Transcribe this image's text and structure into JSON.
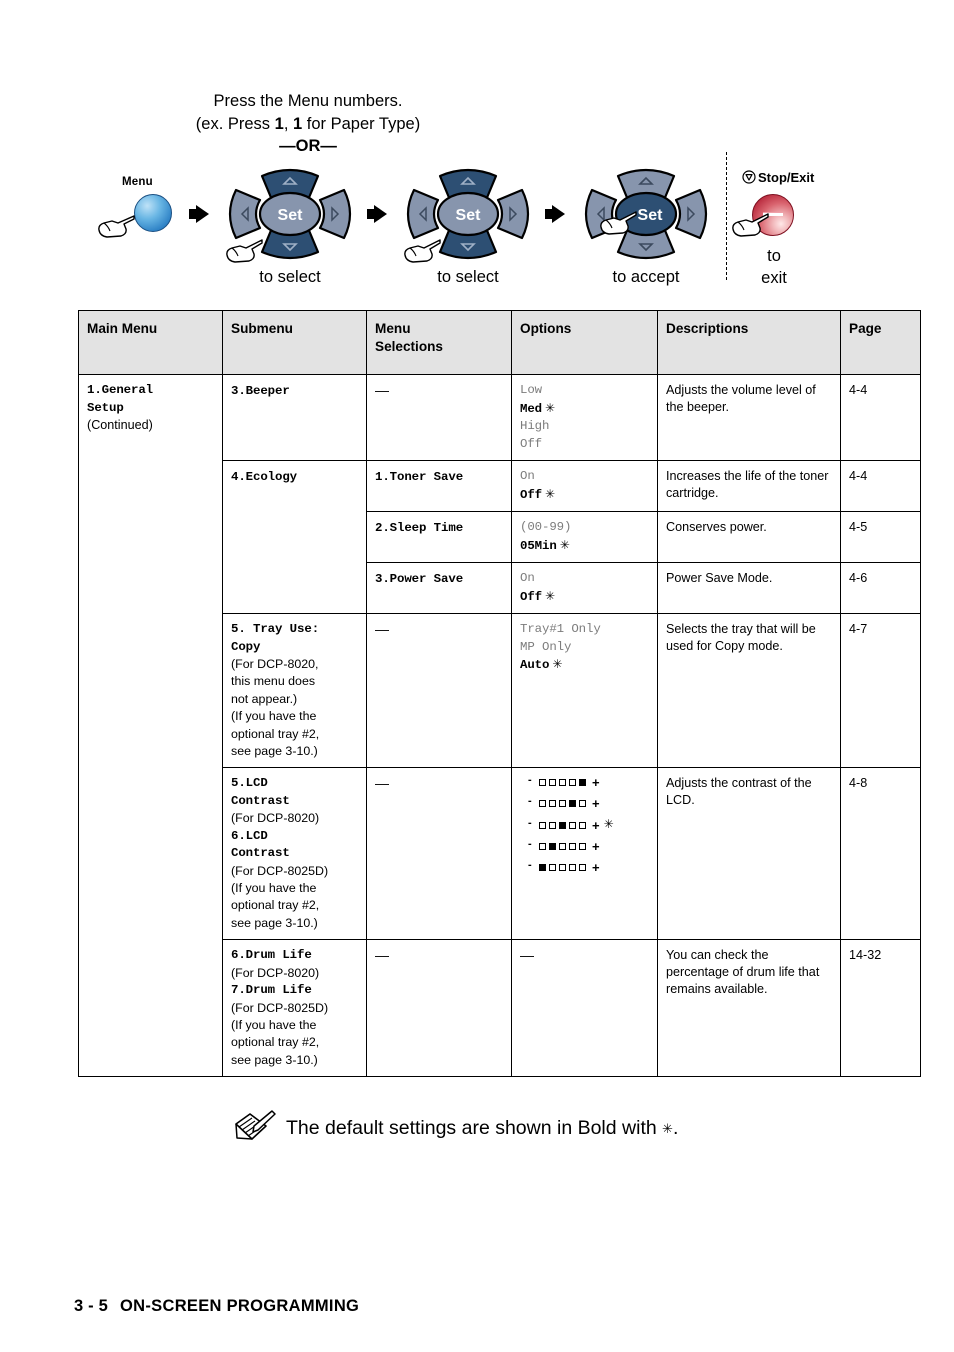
{
  "diagram": {
    "instruction_line1": "Press the Menu numbers.",
    "instruction_line2_pre": "(ex. Press ",
    "instruction_line2_key1": "1",
    "instruction_line2_mid": ", ",
    "instruction_line2_key2": "1",
    "instruction_line2_post": " for Paper Type)",
    "or_label": "—OR—",
    "menu_button_label": "Menu",
    "set_label_1": "Set",
    "set_label_2": "Set",
    "set_label_3": "Set",
    "caption_1": "to select",
    "caption_2": "to select",
    "caption_3": "to accept",
    "stop_exit_label": "Stop/Exit",
    "stop_caption_line1": "to",
    "stop_caption_line2": "exit"
  },
  "table": {
    "headers": {
      "main_menu": "Main Menu",
      "submenu": "Submenu",
      "menu_selections_l1": "Menu",
      "menu_selections_l2": "Selections",
      "options": "Options",
      "descriptions": "Descriptions",
      "page": "Page"
    },
    "main_menu": {
      "line1": "1.General",
      "line2": "Setup",
      "line3": "(Continued)"
    },
    "rows": [
      {
        "submenu": "3.Beeper",
        "selection": "—",
        "options": [
          {
            "text": "Low",
            "default": false
          },
          {
            "text": "Med",
            "default": true
          },
          {
            "text": "High",
            "default": false
          },
          {
            "text": "Off",
            "default": false
          }
        ],
        "description": "Adjusts the volume level of the beeper.",
        "page": "4-4"
      },
      {
        "submenu": "4.Ecology",
        "selection": "1.Toner Save",
        "options": [
          {
            "text": "On",
            "default": false
          },
          {
            "text": "Off",
            "default": true
          }
        ],
        "description": "Increases the life of the toner cartridge.",
        "page": "4-4"
      },
      {
        "submenu": "",
        "selection": "2.Sleep Time",
        "options": [
          {
            "text": "(00-99)",
            "default": false
          },
          {
            "text": "05Min",
            "default": true
          }
        ],
        "description": "Conserves power.",
        "page": "4-5"
      },
      {
        "submenu": "",
        "selection": "3.Power Save",
        "options": [
          {
            "text": "On",
            "default": false
          },
          {
            "text": "Off",
            "default": true
          }
        ],
        "description": "Power Save Mode.",
        "page": "4-6"
      },
      {
        "submenu_mono": [
          "5. Tray Use:",
          "Copy"
        ],
        "submenu_notes": [
          "(For DCP-8020,",
          "this menu does",
          "not appear.)",
          "(If you have the",
          "optional tray #2,",
          "see page 3-10.)"
        ],
        "selection": "—",
        "options": [
          {
            "text": "Tray#1 Only",
            "default": false
          },
          {
            "text": "MP Only",
            "default": false
          },
          {
            "text": "Auto",
            "default": true
          }
        ],
        "description": "Selects the tray that will be used for Copy mode.",
        "page": "4-7"
      },
      {
        "submenu_mono": [
          "5.LCD",
          "Contrast"
        ],
        "submenu_note_a": "(For DCP-8020)",
        "submenu_mono2": [
          "6.LCD",
          "Contrast"
        ],
        "submenu_notes": [
          "(For DCP-8025D)",
          "(If you have the",
          "optional tray #2,",
          "see page 3-10.)"
        ],
        "selection": "—",
        "lcd_bars": [
          {
            "filled_index": 4,
            "total": 5,
            "default": false
          },
          {
            "filled_index": 3,
            "total": 5,
            "default": false
          },
          {
            "filled_index": 2,
            "total": 5,
            "default": true
          },
          {
            "filled_index": 1,
            "total": 5,
            "default": false
          },
          {
            "filled_index": 0,
            "total": 5,
            "default": false
          }
        ],
        "lcd_minus": "-",
        "lcd_plus": "+",
        "description": "Adjusts the contrast of the LCD.",
        "page": "4-8"
      },
      {
        "submenu_mono": [
          "6.Drum Life"
        ],
        "submenu_note_a": "(For DCP-8020)",
        "submenu_mono2": [
          "7.Drum Life"
        ],
        "submenu_notes": [
          "(For DCP-8025D)",
          "(If you have the",
          "optional tray #2,",
          "see page 3-10.)"
        ],
        "selection": "—",
        "options_dash": "—",
        "description": "You can check the percentage of drum life that remains available.",
        "page": "14-32"
      }
    ]
  },
  "note": {
    "text": "The default settings are shown in Bold with",
    "star": "✳",
    "period": "."
  },
  "footer": {
    "page_number": "3 - 5",
    "title": "ON-SCREEN PROGRAMMING"
  },
  "colors": {
    "arrow_dark": "#2d4f73",
    "arrow_light": "#8795ad",
    "set_light": "#8795ad",
    "set_dark": "#2d4f73",
    "menu_blue": "#5ba8de",
    "stop_red": "#c1394b",
    "header_bg": "#e3e3e3"
  }
}
